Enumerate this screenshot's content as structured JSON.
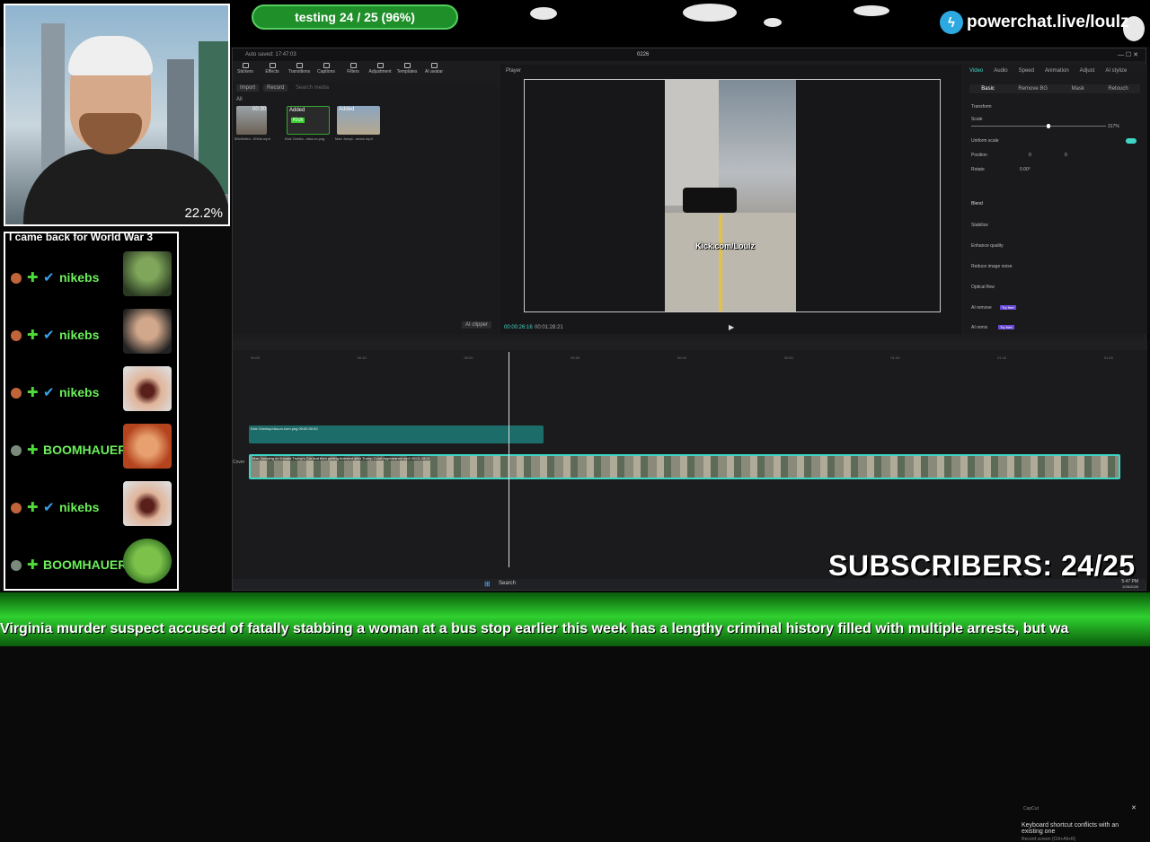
{
  "overlay": {
    "goal_text": "testing 24 / 25 (96%)",
    "goal_progress": 0.96,
    "brand": "powerchat.live/loulz",
    "webcam_zoom": "22.2%",
    "subscribers": "SUBSCRIBERS: 24/25",
    "ticker": "Virginia murder suspect accused of fatally stabbing a woman at a bus stop earlier this week has a lengthy criminal history filled with multiple arrests, but wa"
  },
  "chat": {
    "title": "I came back for World War 3",
    "messages": [
      {
        "name": "nikebs",
        "emote": "zombie-face"
      },
      {
        "name": "nikebs",
        "emote": "streamer-face"
      },
      {
        "name": "nikebs",
        "emote": "screaming-face"
      },
      {
        "name": "BOOMHAUER",
        "emote": "cat-face"
      },
      {
        "name": "nikebs",
        "emote": "screaming-face"
      },
      {
        "name": "BOOMHAUER",
        "emote": "frog-face"
      }
    ]
  },
  "app": {
    "title": "0226",
    "autosave": "Auto saved: 17:47:03",
    "toolbar": [
      "Stickers",
      "Effects",
      "Transitions",
      "Captions",
      "Filters",
      "Adjustment",
      "Templates",
      "AI avatar"
    ],
    "import_label": "Import",
    "record_label": "Record",
    "search_placeholder": "Search media",
    "all_label": "All",
    "media": [
      {
        "name": "5f4d0cfed...f29de.mp4",
        "duration": "00:30"
      },
      {
        "name": "Kick Overla...mka.zx.png",
        "tag": "Added"
      },
      {
        "name": "Man Jumpi...rance.mp4",
        "tag": "Added"
      }
    ],
    "player_label": "Player",
    "kick_label": "Kick.com/Loulz",
    "time_current": "00:00:26:16",
    "time_total": "00:01:28:21",
    "ai_clipper": "AI clipper",
    "tabs": [
      "Video",
      "Audio",
      "Speed",
      "Animation",
      "Adjust",
      "AI stylize"
    ],
    "subtabs": [
      "Basic",
      "Remove BG",
      "Mask",
      "Retouch"
    ],
    "props": [
      "Transform",
      "Scale",
      "Uniform scale",
      "Position",
      "Rotate",
      "Blend",
      "Stabilize",
      "Enhance quality",
      "Reduce image noise",
      "Optical flow",
      "AI remove",
      "AI remix"
    ],
    "scale_value": "317%",
    "position_x": "0",
    "position_y": "0",
    "rotate_value": "0.00°",
    "pill_new": "Try free",
    "clip_overlay": "Kick Overlay.mka.zx.com.png  00:00:30:00",
    "clip_main": "Man Jumping on Donald Trump's Car and then getting Arrested after Trump Court Appearance.mp4  00:01:28:21",
    "cover_label": "Cover",
    "ruler": [
      "00:00",
      "00:10",
      "00:20",
      "00:30",
      "00:40",
      "00:50",
      "01:00",
      "01:10",
      "01:20"
    ],
    "toast_title": "CapCut",
    "toast_body": "Keyboard shortcut conflicts with an existing one",
    "toast_hint": "Record screen (Ctrl+Alt+R)",
    "search_taskbar": "Search",
    "clock_time": "5:47 PM",
    "clock_date": "2/26/2026"
  }
}
